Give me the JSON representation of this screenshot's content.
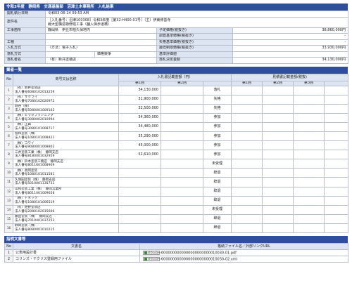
{
  "header": {
    "title": "令和3年度　静岡県　交通基盤部　沼津土木事務所　入札結果"
  },
  "info": {
    "date_label": "開札執行日時",
    "date_value": "令和03-06-24 09:53 AM",
    "case_label": "案件名",
    "case_line1": "［入札番号：沼津100308］令和3年度［第32-H400-01号］（主）伊東修善寺",
    "case_line2": "線大型構造物修繕工事（舗入保歩道橋）",
    "place_label": "工事箇所",
    "place_value": "静岡県　伊豆市柏久保地内",
    "type_label": "工種",
    "type_value": "",
    "method_label": "入札方式",
    "method_value": "（方法：電子入札）",
    "decision_label": "落札方式",
    "decision_value": "価格競争",
    "winner_label": "落札者名",
    "winner_value": "（有）新井塗装店",
    "est_label": "予定価格(税抜き)",
    "est_value": "38,860,000円",
    "survey_label": "調査基準価格(税抜き)",
    "survey_value": "-",
    "fail_label": "失格基準価格(税抜き)",
    "fail_value": "-",
    "min_label": "最低制限価格(税抜き)",
    "min_value": "33,930,000円",
    "std_label": "基準評価値",
    "std_value": "",
    "final_label": "落札決定金額",
    "final_value": "34,130,000円"
  },
  "bidders": {
    "section_title": "業者一覧",
    "col_no": "No",
    "col_name": "商号又は名称",
    "col_bid": "入札書記載金額（円）",
    "col_alt": "見積書記載金額(税抜)",
    "col_r1": "第1回",
    "col_r2": "第2回",
    "col_r3": "第3回",
    "col_a1": "第1回",
    "col_a2": "第2回",
    "col_a3": "第3回",
    "rows": [
      {
        "no": "1",
        "name": "（有）新井塗装店",
        "corp": "法人番号6080102013259",
        "amount": "34,130,000",
        "status": "落札"
      },
      {
        "no": "2",
        "name": "（有）サクライ",
        "corp": "法人番号7080102020972",
        "amount": "31,900,000",
        "status": "失格"
      },
      {
        "no": "3",
        "name": "堀谷（株）",
        "corp": "法人番号5080001009103",
        "amount": "32,500,000",
        "status": "失格"
      },
      {
        "no": "4",
        "name": "（株）ヒラタプランニング",
        "corp": "法人番号3080002010994",
        "amount": "34,360,000",
        "status": "参加"
      },
      {
        "no": "5",
        "name": "（株）正興",
        "corp": "法人番号3080101008717",
        "amount": "34,480,000",
        "status": "参加"
      },
      {
        "no": "6",
        "name": "協和塗装（株）",
        "corp": "法人番号1080101008421",
        "amount": "35,290,000",
        "status": "参加"
      },
      {
        "no": "7",
        "name": "（株）コワイ",
        "corp": "法人番号9080001008802",
        "amount": "45,000,000",
        "status": "参加"
      },
      {
        "no": "8",
        "name": "三井塗装工業（株）　静岡支店",
        "corp": "法人番号8180001032959",
        "amount": "52,610,000",
        "status": "参加"
      },
      {
        "no": "9",
        "name": "（株）鈴木塗装工務店　静岡支店",
        "corp": "法人番号8011601008909",
        "amount": "",
        "status": "未受理"
      },
      {
        "no": "10",
        "name": "（株）高岡塗装",
        "corp": "法人番号1080101011581",
        "amount": "",
        "status": "辞退"
      },
      {
        "no": "11",
        "name": "久保田塗装（株）　静岡支店",
        "corp": "法人番号5010001135731",
        "amount": "",
        "status": "辞退"
      },
      {
        "no": "12",
        "name": "山和塗装工業（株）　静岡営業所",
        "corp": "法人番号8011001009658",
        "amount": "",
        "status": "辞退"
      },
      {
        "no": "13",
        "name": "（株）トネック",
        "corp": "法人番号1080101006519",
        "amount": "",
        "status": "辞退"
      },
      {
        "no": "14",
        "name": "（有）佐野塗装店",
        "corp": "法人番号2080102015606",
        "amount": "",
        "status": "未受理"
      },
      {
        "no": "15",
        "name": "藤田塗装（株）　静岡支店",
        "corp": "法人番号7010401037253",
        "amount": "",
        "status": "辞退"
      },
      {
        "no": "16",
        "name": "静岡塗装（株）",
        "corp": "法人番号8080001010215",
        "amount": "",
        "status": "辞退"
      }
    ]
  },
  "documents": {
    "section_title": "指明文書等",
    "col_no": "No",
    "col_name": "文書名",
    "col_file": "格納ファイル名／外部リンクURL",
    "download_label": "ダウンロード",
    "rows": [
      {
        "no": "1",
        "name": "公表用設計書",
        "file": "0000000000000000000000010030-01.pdf"
      },
      {
        "no": "2",
        "name": "コリンズ・テクリス登録用ファイル",
        "file": "0000000000000000000000010030-02.xml"
      }
    ]
  }
}
